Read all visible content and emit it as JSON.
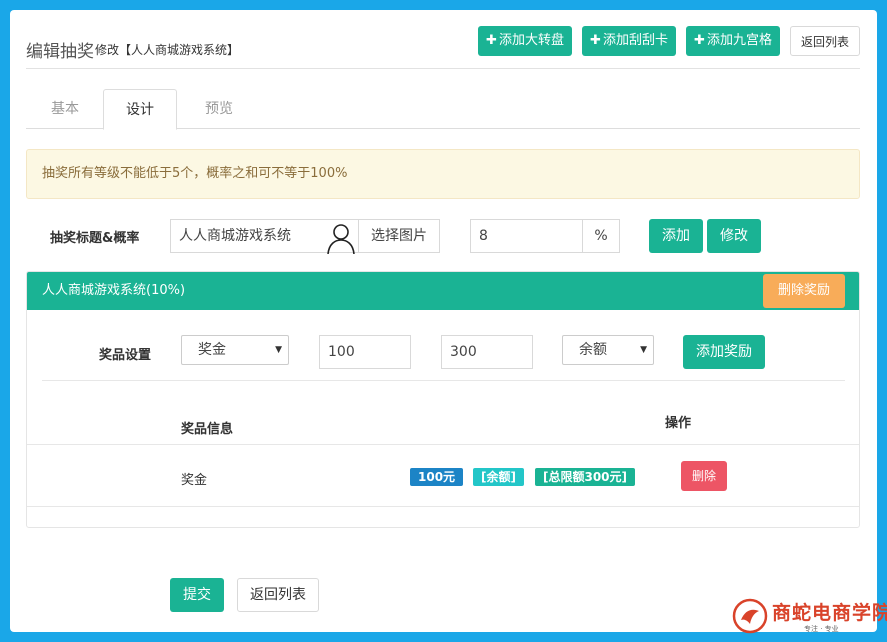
{
  "header": {
    "title": "编辑抽奖",
    "subtitle": "修改【人人商城游戏系统】",
    "buttons": [
      "添加大转盘",
      "添加刮刮卡",
      "添加九宫格"
    ],
    "back_label": "返回列表"
  },
  "tabs": [
    "基本",
    "设计",
    "预览"
  ],
  "alert": "抽奖所有等级不能低于5个，概率之和可不等于100%",
  "row1": {
    "label": "抽奖标题&概率",
    "title_value": "人人商城游戏系统",
    "select_image_label": "选择图片",
    "rate_value": "8",
    "rate_unit": "%",
    "add_label": "添加",
    "edit_label": "修改"
  },
  "prize_panel": {
    "heading": "人人商城游戏系统(10%)",
    "delete_label": "删除奖励",
    "setting_label": "奖品设置",
    "type_select": "奖金",
    "amount1": "100",
    "amount2": "300",
    "target_select": "余额",
    "add_prize_label": "添加奖励",
    "col_info": "奖品信息",
    "col_action": "操作",
    "rows": [
      {
        "name": "奖金",
        "badges": [
          "100元",
          "[余额]",
          "[总限额300元]"
        ],
        "delete_label": "删除"
      }
    ]
  },
  "footer": {
    "submit_label": "提交",
    "back_label": "返回列表"
  },
  "watermark": {
    "name": "商蛇电商学院",
    "tagline": "专注 · 专业"
  },
  "colors": {
    "background": "#1aa7e8",
    "primary": "#1ab394",
    "warning": "#f8ac59",
    "danger": "#ed5565",
    "badge_blue": "#1c84c6",
    "badge_cyan": "#23c6c8"
  }
}
